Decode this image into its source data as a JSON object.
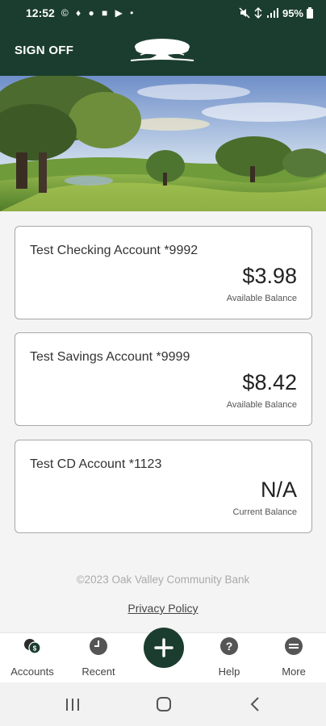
{
  "status_bar": {
    "time": "12:52",
    "notification_icons": "© ♦ ● ■ ▶ •",
    "battery": "95%"
  },
  "header": {
    "sign_off_label": "SIGN OFF",
    "logo_icon": "oak-tree-logo"
  },
  "accounts": [
    {
      "name": "Test Checking Account  *9992",
      "amount": "$3.98",
      "balance_label": "Available Balance"
    },
    {
      "name": "Test Savings Account *9999",
      "amount": "$8.42",
      "balance_label": "Available Balance"
    },
    {
      "name": "Test CD Account *1123",
      "amount": "N/A",
      "balance_label": "Current Balance"
    }
  ],
  "footer": {
    "copyright": "©2023 Oak Valley Community Bank",
    "privacy_link": "Privacy Policy"
  },
  "tabs": [
    {
      "label": "Accounts",
      "icon": "coins-icon"
    },
    {
      "label": "Recent",
      "icon": "clock-icon"
    },
    {
      "label": "",
      "icon": "plus-icon"
    },
    {
      "label": "Help",
      "icon": "help-icon"
    },
    {
      "label": "More",
      "icon": "menu-icon"
    }
  ],
  "colors": {
    "brand_green": "#1b3d2f",
    "background": "#f4f4f4"
  }
}
